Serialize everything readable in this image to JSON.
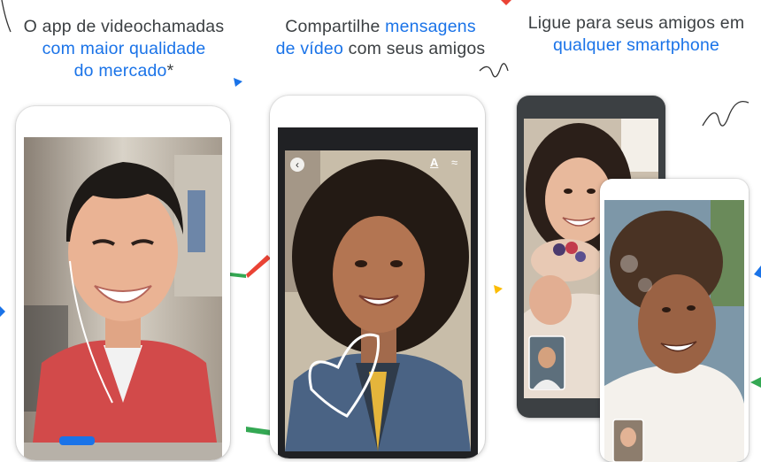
{
  "captions": [
    {
      "line1": "O app de videochamadas",
      "line2": "com maior qualidade",
      "line3": "do mercado",
      "suffix": "*"
    },
    {
      "line1_plain": "Compartilhe ",
      "line1_accent": "mensagens",
      "line2_accent": "de vídeo",
      "line2_plain": " com seus amigos"
    },
    {
      "line1": "Ligue para seus amigos em",
      "line2": "qualquer smartphone"
    }
  ],
  "colors": {
    "accent": "#1a73e8",
    "text": "#3c4043",
    "confetti_blue": "#1a73e8",
    "confetti_red": "#ea4335",
    "confetti_green": "#34a853",
    "confetti_yellow": "#fbbc04"
  },
  "message_toolbar": {
    "back_icon": "back-arrow-icon",
    "text_tool_label": "A",
    "draw_tool_icon": "doodle-icon"
  }
}
